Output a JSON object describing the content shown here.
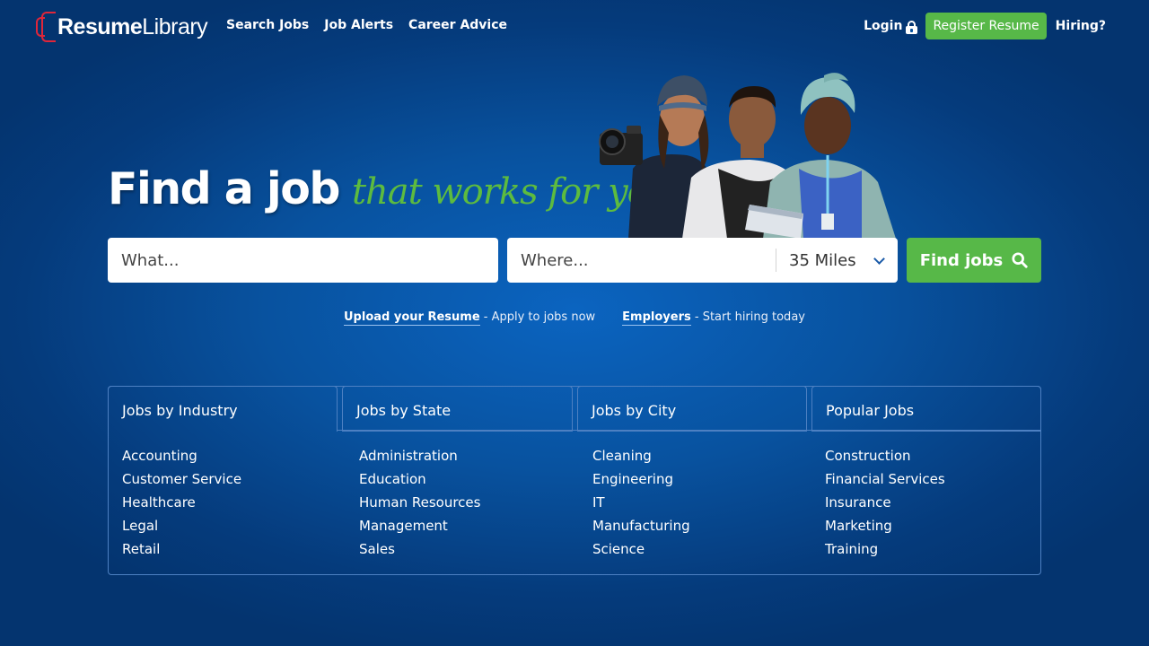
{
  "brand": {
    "resume": "Resume",
    "library": "Library"
  },
  "nav": {
    "search_jobs": "Search Jobs",
    "job_alerts": "Job Alerts",
    "career_advice": "Career Advice"
  },
  "header_right": {
    "login": "Login",
    "register": "Register Resume",
    "hiring": "Hiring?"
  },
  "hero": {
    "title_main": "Find a job",
    "title_accent": "that works for you"
  },
  "search": {
    "what_placeholder": "What...",
    "where_placeholder": "Where...",
    "radius": "35 Miles",
    "find_label": "Find jobs"
  },
  "sub_links": {
    "upload_label": "Upload your Resume",
    "upload_suffix": " - Apply to jobs now",
    "employers_label": "Employers",
    "employers_suffix": " - Start hiring today"
  },
  "tabs": [
    {
      "label": "Jobs by Industry"
    },
    {
      "label": "Jobs by State"
    },
    {
      "label": "Jobs by City"
    },
    {
      "label": "Popular Jobs"
    }
  ],
  "columns": [
    [
      "Accounting",
      "Customer Service",
      "Healthcare",
      "Legal",
      "Retail"
    ],
    [
      "Administration",
      "Education",
      "Human Resources",
      "Management",
      "Sales"
    ],
    [
      "Cleaning",
      "Engineering",
      "IT",
      "Manufacturing",
      "Science"
    ],
    [
      "Construction",
      "Financial Services",
      "Insurance",
      "Marketing",
      "Training"
    ]
  ],
  "colors": {
    "accent_green": "#57b848",
    "brand_red": "#e0263a",
    "background_blue": "#08529f"
  }
}
